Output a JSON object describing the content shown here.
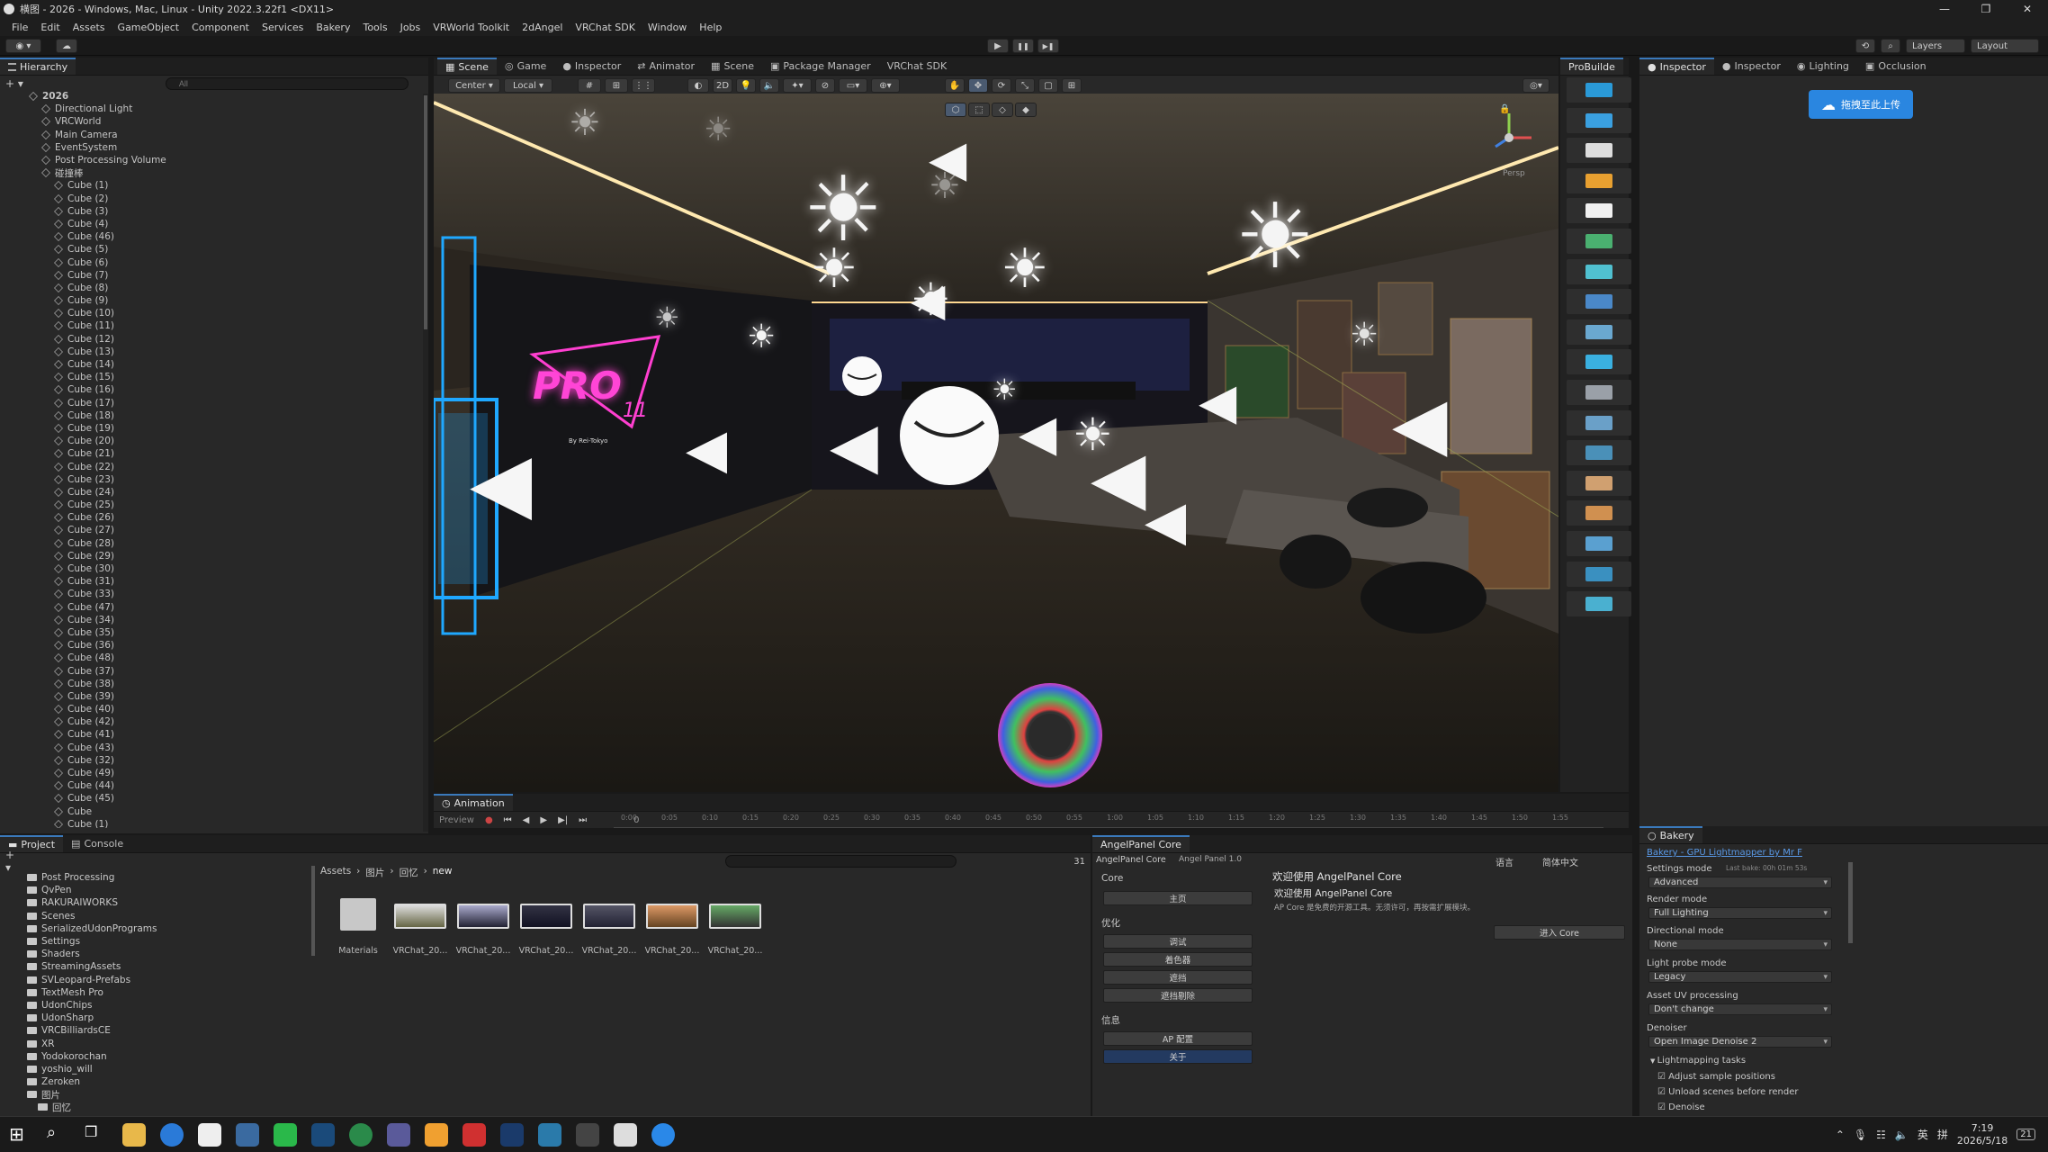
{
  "title_bar": {
    "title": "横图 - 2026 - Windows, Mac, Linux - Unity 2022.3.22f1 <DX11>",
    "min": "—",
    "max": "❐",
    "close": "✕"
  },
  "menu": [
    "File",
    "Edit",
    "Assets",
    "GameObject",
    "Component",
    "Services",
    "Bakery",
    "Tools",
    "Jobs",
    "VRWorld Toolkit",
    "2dAngel",
    "VRChat SDK",
    "Window",
    "Help"
  ],
  "toolbar": {
    "play": "▶",
    "pause": "❚❚",
    "step": "▶❚",
    "layers": "Layers",
    "layout": "Layout"
  },
  "hierarchy": {
    "tab": "Hierarchy",
    "search_placeholder": "All",
    "root": "2026",
    "items": [
      "Directional Light",
      "VRCWorld",
      "Main Camera",
      "EventSystem",
      "Post Processing Volume"
    ],
    "group": "碰撞棒",
    "cubes": [
      "Cube (1)",
      "Cube (2)",
      "Cube (3)",
      "Cube (4)",
      "Cube (46)",
      "Cube (5)",
      "Cube (6)",
      "Cube (7)",
      "Cube (8)",
      "Cube (9)",
      "Cube (10)",
      "Cube (11)",
      "Cube (12)",
      "Cube (13)",
      "Cube (14)",
      "Cube (15)",
      "Cube (16)",
      "Cube (17)",
      "Cube (18)",
      "Cube (19)",
      "Cube (20)",
      "Cube (21)",
      "Cube (22)",
      "Cube (23)",
      "Cube (24)",
      "Cube (25)",
      "Cube (26)",
      "Cube (27)",
      "Cube (28)",
      "Cube (29)",
      "Cube (30)",
      "Cube (31)",
      "Cube (33)",
      "Cube (47)",
      "Cube (34)",
      "Cube (35)",
      "Cube (36)",
      "Cube (48)",
      "Cube (37)",
      "Cube (38)",
      "Cube (39)",
      "Cube (40)",
      "Cube (42)",
      "Cube (41)",
      "Cube (43)",
      "Cube (32)",
      "Cube (49)",
      "Cube (44)",
      "Cube (45)",
      "Cube",
      "Cube (1)"
    ]
  },
  "center_tabs": [
    "Scene",
    "Game",
    "Inspector",
    "Animator",
    "Scene",
    "Package Manager",
    "VRChat SDK"
  ],
  "scene_toolbar": {
    "pivot": "Center",
    "space": "Local",
    "mode2d": "2D"
  },
  "scene": {
    "persp_label": "Persp",
    "sign_text": "PRO",
    "sign_sub": "By Rei-Tokyo",
    "neon_num": "11"
  },
  "probuilder_tab": "ProBuilde",
  "right_tabs": [
    "Inspector",
    "Inspector",
    "Lighting",
    "Occlusion"
  ],
  "upload_button": "拖拽至此上传",
  "animation": {
    "tab": "Animation",
    "preview": "Preview",
    "frame": "0",
    "ticks": [
      "0:00",
      "0:05",
      "0:10",
      "0:15",
      "0:20",
      "0:25",
      "0:30",
      "0:35",
      "0:40",
      "0:45",
      "0:50",
      "0:55",
      "1:00",
      "1:05",
      "1:10",
      "1:15",
      "1:20",
      "1:25",
      "1:30",
      "1:35",
      "1:40",
      "1:45",
      "1:50",
      "1:55"
    ]
  },
  "project": {
    "tabs": [
      "Project",
      "Console"
    ],
    "folders": [
      "Post Processing",
      "QvPen",
      "RAKURAIWORKS",
      "Scenes",
      "SerializedUdonPrograms",
      "Settings",
      "Shaders",
      "StreamingAssets",
      "SVLeopard-Prefabs",
      "TextMesh Pro",
      "UdonChips",
      "UdonSharp",
      "VRCBilliardsCE",
      "XR",
      "Yodokorochan",
      "yoshio_will",
      "Zeroken",
      "图片",
      "回忆",
      "Materials"
    ],
    "breadcrumb": [
      "Assets",
      "图片",
      "回忆",
      "new"
    ],
    "asset_count": "31",
    "assets": [
      "Materials",
      "VRChat_20...",
      "VRChat_20...",
      "VRChat_20...",
      "VRChat_20...",
      "VRChat_20...",
      "VRChat_20..."
    ]
  },
  "angel_panel": {
    "tab": "AngelPanel Core",
    "header_tab": "AngelPanel Core",
    "version": "Angel Panel 1.0",
    "lang_label": "语言",
    "lang_value": "简体中文",
    "sec_core": "Core",
    "btn_home": "主页",
    "sec_opt": "优化",
    "btn_opt": [
      "调试",
      "着色器",
      "遮挡",
      "遮挡剔除"
    ],
    "sec_info": "信息",
    "btn_info": [
      "AP 配置",
      "关于"
    ],
    "welcome": "欢迎使用 AngelPanel Core",
    "welcome2": "欢迎使用 AngelPanel Core",
    "desc": "AP Core 是免费的开源工具。无须许可，再按需扩展模块。",
    "enter_btn": "进入 Core"
  },
  "bakery": {
    "tab": "Bakery",
    "link": "Bakery - GPU Lightmapper by Mr F",
    "settings_label": "Settings mode",
    "last_bake": "Last bake: 00h 01m 53s",
    "settings_value": "Advanced",
    "render_label": "Render mode",
    "render_value": "Full Lighting",
    "dir_label": "Directional mode",
    "dir_value": "None",
    "probe_label": "Light probe mode",
    "probe_value": "Legacy",
    "uv_label": "Asset UV processing",
    "uv_value": "Don't change",
    "denoiser_label": "Denoiser",
    "denoiser_value": "Open Image Denoise 2",
    "tasks_label": "Lightmapping tasks",
    "tasks": [
      "Adjust sample positions",
      "Unload scenes before render",
      "Denoise"
    ]
  },
  "taskbar": {
    "time": "7:19",
    "date": "2026/5/18",
    "ime": "英",
    "ime2": "拼",
    "notif": "21"
  },
  "colors": {
    "accent": "#3a79bb",
    "bg": "#282828",
    "dark": "#191919"
  }
}
